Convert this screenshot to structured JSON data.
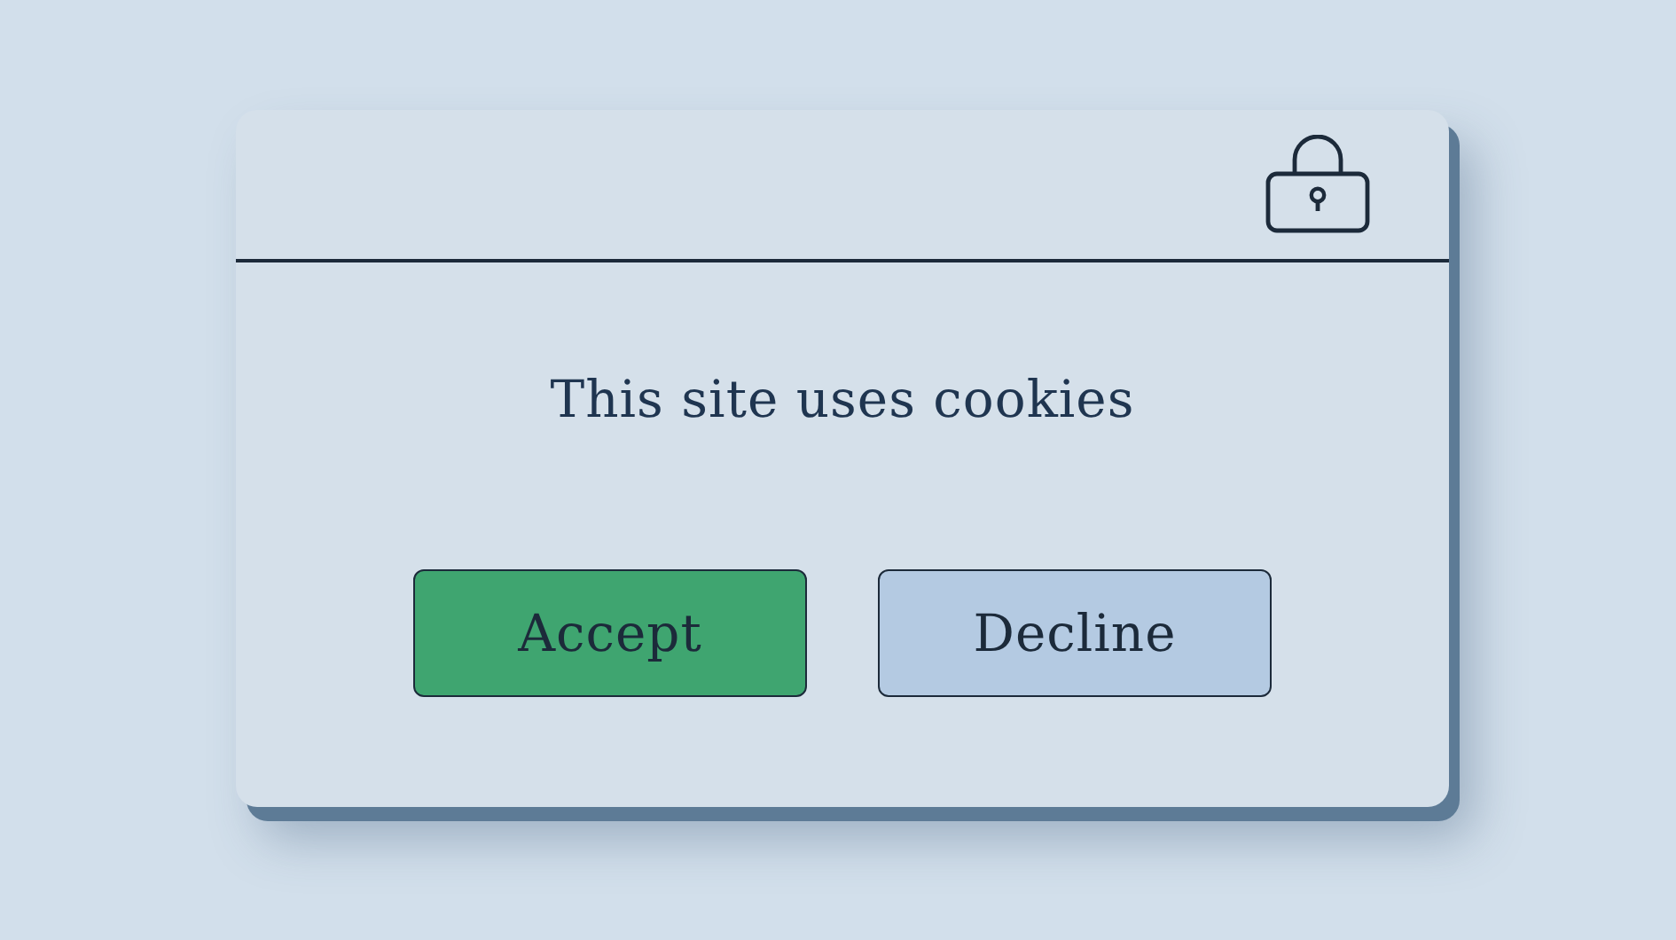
{
  "dialog": {
    "message": "This site uses cookies",
    "buttons": [
      {
        "label": "Accept",
        "kind": "primary"
      },
      {
        "label": "Decline",
        "kind": "secondary"
      }
    ]
  }
}
